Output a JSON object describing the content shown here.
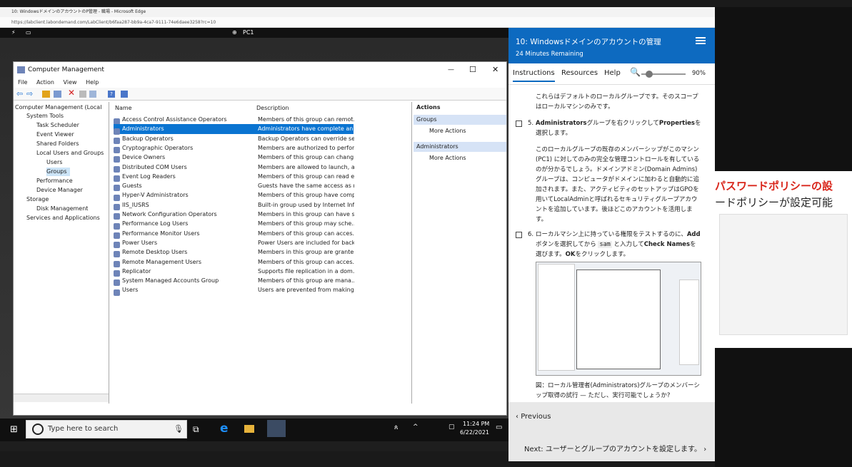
{
  "browser": {
    "tab_title": "10: WindowsドメインのアカウントのP管理 - 職場 - Microsoft Edge",
    "url": "https://labclient.labondemand.com/LabClient/b6faa287-bb9a-4ca7-9111-74e6daee3258?rc=10"
  },
  "vm": {
    "name": "PC1"
  },
  "cm": {
    "title": "Computer Management",
    "menu": [
      "File",
      "Action",
      "View",
      "Help"
    ],
    "tree": [
      "Computer Management (Local",
      "System Tools",
      "Task Scheduler",
      "Event Viewer",
      "Shared Folders",
      "Local Users and Groups",
      "Users",
      "Groups",
      "Performance",
      "Device Manager",
      "Storage",
      "Disk Management",
      "Services and Applications"
    ],
    "col_name": "Name",
    "col_desc": "Description",
    "rows": [
      {
        "name": "Access Control Assistance Operators",
        "desc": "Members of this group can remot..."
      },
      {
        "name": "Administrators",
        "desc": "Administrators have complete an..."
      },
      {
        "name": "Backup Operators",
        "desc": "Backup Operators can override se..."
      },
      {
        "name": "Cryptographic Operators",
        "desc": "Members are authorized to perfor..."
      },
      {
        "name": "Device Owners",
        "desc": "Members of this group can chang..."
      },
      {
        "name": "Distributed COM Users",
        "desc": "Members are allowed to launch, a..."
      },
      {
        "name": "Event Log Readers",
        "desc": "Members of this group can read e..."
      },
      {
        "name": "Guests",
        "desc": "Guests have the same access as m..."
      },
      {
        "name": "Hyper-V Administrators",
        "desc": "Members of this group have comp..."
      },
      {
        "name": "IIS_IUSRS",
        "desc": "Built-in group used by Internet Inf..."
      },
      {
        "name": "Network Configuration Operators",
        "desc": "Members in this group can have s..."
      },
      {
        "name": "Performance Log Users",
        "desc": "Members of this group may sche..."
      },
      {
        "name": "Performance Monitor Users",
        "desc": "Members of this group can acces..."
      },
      {
        "name": "Power Users",
        "desc": "Power Users are included for back..."
      },
      {
        "name": "Remote Desktop Users",
        "desc": "Members in this group are grante..."
      },
      {
        "name": "Remote Management Users",
        "desc": "Members of this group can acces..."
      },
      {
        "name": "Replicator",
        "desc": "Supports file replication in a dom..."
      },
      {
        "name": "System Managed Accounts Group",
        "desc": "Members of this group are mana..."
      },
      {
        "name": "Users",
        "desc": "Users are prevented from making ..."
      }
    ],
    "actions": {
      "header": "Actions",
      "groups": "Groups",
      "admins": "Administrators",
      "more": "More Actions"
    }
  },
  "taskbar": {
    "search_placeholder": "Type here to search",
    "time": "11:24 PM",
    "date": "6/22/2021"
  },
  "lab": {
    "title": "10: Windowsドメインのアカウントの管理",
    "remaining": "24 Minutes Remaining",
    "tabs": [
      "Instructions",
      "Resources",
      "Help"
    ],
    "zoom": "90%",
    "p1": "これらはデフォルトのローカルグループです。そのスコープはローカルマシンのみです。",
    "step5_num": "5.",
    "step5_a": "Administrators",
    "step5_b": "グループを右クリックして",
    "step5_c": "Properties",
    "step5_d": "を選択します。",
    "p2": "このローカルグループの既存のメンバーシップがこのマシン(PC1) に対してのみの完全な管理コントロールを有しているのが分かるでしょう。ドメインアドミン(Domain Admins)グループは、コンピュータがドメインに加わると自動的に追加されます。また、アクティビティのセットアップはGPOを用いてLocalAdminと呼ばれるセキュリティグループアカウントを追加しています。後ほどこのアカウントを活用します。",
    "step6_num": "6.",
    "step6_a": "ローカルマシン上に持っている権限をテストするのに、",
    "step6_b": "Add",
    "step6_c": "ボタンを選択してから",
    "step6_d": "sam",
    "step6_e": "と入力して",
    "step6_f": "Check Names",
    "step6_g": "を選びます。",
    "step6_h": "OK",
    "step6_i": "をクリックします。",
    "caption": "図：ローカル管理者(Administrators)グループのメンバーシップ取得の試行 — ただし、実行可能でしょうか?",
    "prev": "Previous",
    "next": "Next: ユーザーとグループのアカウントを設定します。"
  },
  "right_bg": {
    "line1": "パスワードポリシーの設",
    "line2": "ードポリシーが設定可能"
  }
}
